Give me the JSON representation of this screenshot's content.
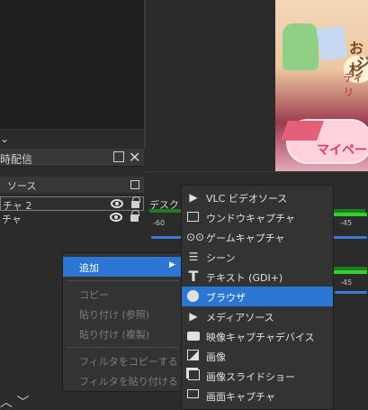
{
  "scenes_panel": {
    "title": "時配信"
  },
  "sources_panel": {
    "title": "ソース",
    "items": [
      {
        "label": "チャ 2"
      },
      {
        "label": "チャ"
      }
    ]
  },
  "mixer": {
    "track_label": "デスクト",
    "ticks": [
      "-60",
      "-45",
      "-45"
    ]
  },
  "preview": {
    "banner_line1": "お杉",
    "banner_line2": "ジ",
    "banner_line3": "ティリ",
    "banner_line4": "マイペー"
  },
  "context_menu": {
    "items": [
      {
        "label": "追加",
        "has_submenu": true,
        "enabled": true
      },
      {
        "label": "コピー",
        "enabled": false
      },
      {
        "label": "貼り付け (参照)",
        "enabled": false
      },
      {
        "label": "貼り付け (複製)",
        "enabled": false
      },
      {
        "label": "フィルタをコピーする",
        "enabled": false
      },
      {
        "label": "フィルタを貼り付ける",
        "enabled": false
      }
    ]
  },
  "add_submenu": {
    "items": [
      {
        "label": "VLC ビデオソース",
        "icon": "play-icon"
      },
      {
        "label": "ウンドウキャプチャ",
        "icon": "window-icon"
      },
      {
        "label": "ゲームキャプチャ",
        "icon": "gamepad-icon"
      },
      {
        "label": "シーン",
        "icon": "list-icon"
      },
      {
        "label": "テキスト (GDI+)",
        "icon": "text-icon"
      },
      {
        "label": "ブラウザ",
        "icon": "globe-icon",
        "selected": true
      },
      {
        "label": "メディアソース",
        "icon": "play-icon"
      },
      {
        "label": "映像キャプチャデバイス",
        "icon": "camera-icon"
      },
      {
        "label": "画像",
        "icon": "image-icon"
      },
      {
        "label": "画像スライドショー",
        "icon": "images-icon"
      },
      {
        "label": "画面キャプチャ",
        "icon": "monitor-icon"
      }
    ]
  },
  "colors": {
    "highlight": "#2a76d2",
    "menu_bg": "#333333",
    "meter_green": "#2fd12f",
    "slider_blue": "#3b7bd6"
  }
}
